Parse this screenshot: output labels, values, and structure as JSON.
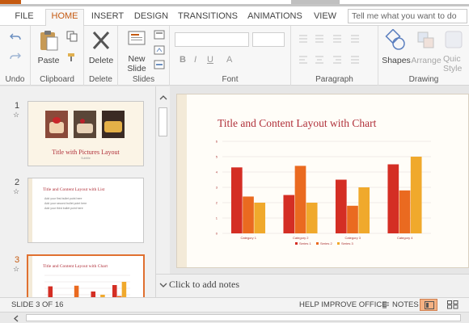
{
  "tabs": [
    {
      "label": "FILE"
    },
    {
      "label": "HOME"
    },
    {
      "label": "INSERT"
    },
    {
      "label": "DESIGN"
    },
    {
      "label": "TRANSITIONS"
    },
    {
      "label": "ANIMATIONS"
    },
    {
      "label": "VIEW"
    }
  ],
  "tell_me": {
    "placeholder": "Tell me what you want to do"
  },
  "ribbon": {
    "groups": {
      "undo": "Undo",
      "clipboard": "Clipboard",
      "delete": "Delete",
      "slides": "Slides",
      "font": "Font",
      "paragraph": "Paragraph",
      "drawing": "Drawing"
    },
    "buttons": {
      "paste": "Paste",
      "delete": "Delete",
      "new_slide_line1": "New",
      "new_slide_line2": "Slide",
      "shapes": "Shapes",
      "arrange": "Arrange",
      "quick_styles_line1": "Quic",
      "quick_styles_line2": "Style"
    }
  },
  "thumbnails": [
    {
      "number": "1",
      "title": "Title with Pictures Layout",
      "subtitle": "Subtitle"
    },
    {
      "number": "2",
      "title": "Title and Content Layout with List",
      "bullets": [
        "Add your first bullet point here",
        "Add your second bullet point here",
        "Add your third bullet point here"
      ]
    },
    {
      "number": "3",
      "title": "Title and Content Layout with Chart"
    }
  ],
  "slide": {
    "title": "Title and Content Layout with Chart"
  },
  "chart_data": {
    "type": "bar",
    "categories": [
      "Category 1",
      "Category 2",
      "Category 3",
      "Category 4"
    ],
    "series": [
      {
        "name": "Series 1",
        "values": [
          4.3,
          2.5,
          3.5,
          4.5
        ],
        "color": "#d42e24"
      },
      {
        "name": "Series 2",
        "values": [
          2.4,
          4.4,
          1.8,
          2.8
        ],
        "color": "#ea6a20"
      },
      {
        "name": "Series 3",
        "values": [
          2.0,
          2.0,
          3.0,
          5.0
        ],
        "color": "#f0a92c"
      }
    ],
    "ylim": [
      0,
      6
    ],
    "yticks": [
      "0",
      "1",
      "2",
      "3",
      "4",
      "5",
      "6"
    ],
    "grid": true,
    "legend": "bottom"
  },
  "notes": {
    "placeholder": "Click to add notes"
  },
  "status": {
    "slide_indicator": "SLIDE 3 OF 16",
    "help": "HELP IMPROVE OFFICE",
    "notes": "NOTES"
  },
  "colors": {
    "accent": "#c55a11",
    "title_red": "#b0303a"
  }
}
